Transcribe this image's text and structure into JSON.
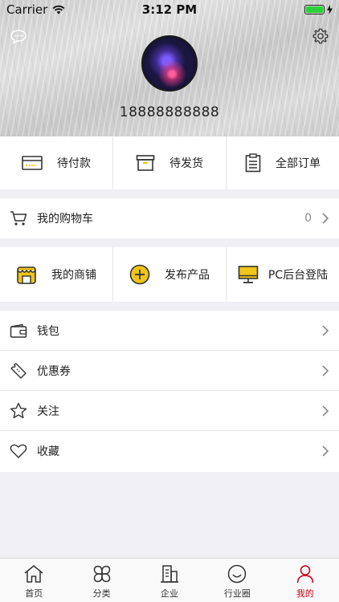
{
  "status_bar": {
    "carrier": "Carrier",
    "time": "3:12 PM"
  },
  "profile": {
    "phone": "18888888888"
  },
  "orders": [
    {
      "label": "待付款",
      "icon": "card-icon"
    },
    {
      "label": "待发货",
      "icon": "box-icon"
    },
    {
      "label": "全部订单",
      "icon": "clipboard-icon"
    }
  ],
  "cart": {
    "label": "我的购物车",
    "count": "0"
  },
  "shop": [
    {
      "label": "我的商铺",
      "icon": "store-icon"
    },
    {
      "label": "发布产品",
      "icon": "plus-circle-icon"
    },
    {
      "label": "PC后台登陆",
      "icon": "monitor-icon"
    }
  ],
  "menu": [
    {
      "label": "钱包",
      "icon": "wallet-icon"
    },
    {
      "label": "优惠券",
      "icon": "coupon-icon"
    },
    {
      "label": "关注",
      "icon": "star-icon"
    },
    {
      "label": "收藏",
      "icon": "heart-icon"
    }
  ],
  "tabs": [
    {
      "label": "首页",
      "icon": "home-icon"
    },
    {
      "label": "分类",
      "icon": "category-icon"
    },
    {
      "label": "企业",
      "icon": "building-icon"
    },
    {
      "label": "行业圈",
      "icon": "smile-icon"
    },
    {
      "label": "我的",
      "icon": "user-icon"
    }
  ],
  "colors": {
    "accent": "#d0021b",
    "icon_yellow": "#f0c419",
    "battery": "#2bd13a"
  }
}
